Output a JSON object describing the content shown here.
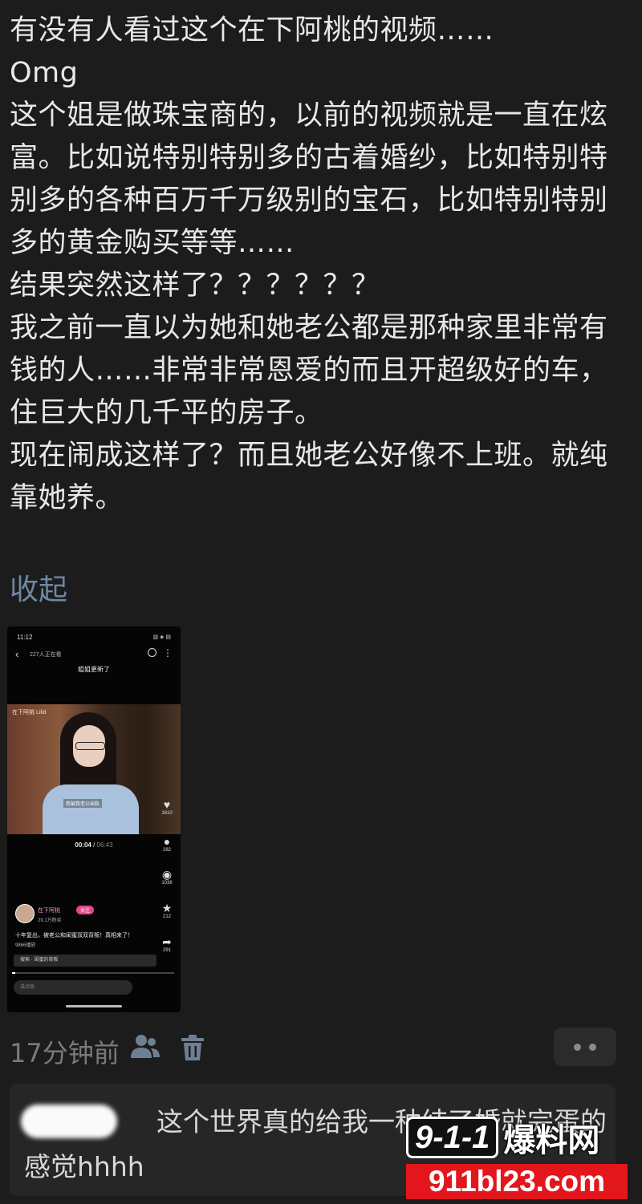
{
  "post": {
    "lines": [
      "有没有人看过这个在下阿桃的视频……",
      "Omg",
      "这个姐是做珠宝商的，以前的视频就是一直在炫富。比如说特别特别多的古着婚纱，比如特别特别多的各种百万千万级别的宝石，比如特别特别多的黄金购买等等……",
      "结果突然这样了？？？？？？",
      "我之前一直以为她和她老公都是那种家里非常有钱的人……非常非常恩爱的而且开超级好的车，住巨大的几千平的房子。",
      "现在闹成这样了？而且她老公好像不上班。就纯靠她养。"
    ],
    "collapse_label": "收起"
  },
  "screenshot": {
    "status_time": "11:12",
    "status_icons": "▥ ◈ ▤",
    "viewers": "227人正在看",
    "caption": "姐姐更新了",
    "video_logo": "在下阿桃 Lilid",
    "subtitle": "我被我老公出轨",
    "time_current": "00:04",
    "time_total": "06:43",
    "likes": "1610",
    "comments": "282",
    "shares_label": "1036",
    "favorites": "212",
    "forwards": "291",
    "author": "在下阿桃",
    "follow_label": "关注",
    "fans": "29.1万粉丝",
    "video_title": "十年复出，被老公和闺蜜双双背叛！真相来了！",
    "plays": "9866播放",
    "search_hint": "搜索 · 闺蜜的背叛",
    "input_placeholder": "说点啥"
  },
  "meta": {
    "time_ago": "17分钟前",
    "users_icon": "users-icon",
    "trash_icon": "trash-icon"
  },
  "comment": {
    "text": "　　　　　这个世界真的给我一种结了婚就完蛋的感觉hhhh"
  },
  "watermark": {
    "badge": "9-1-1",
    "site_cn": "爆料网",
    "url": "911bl23.com"
  }
}
